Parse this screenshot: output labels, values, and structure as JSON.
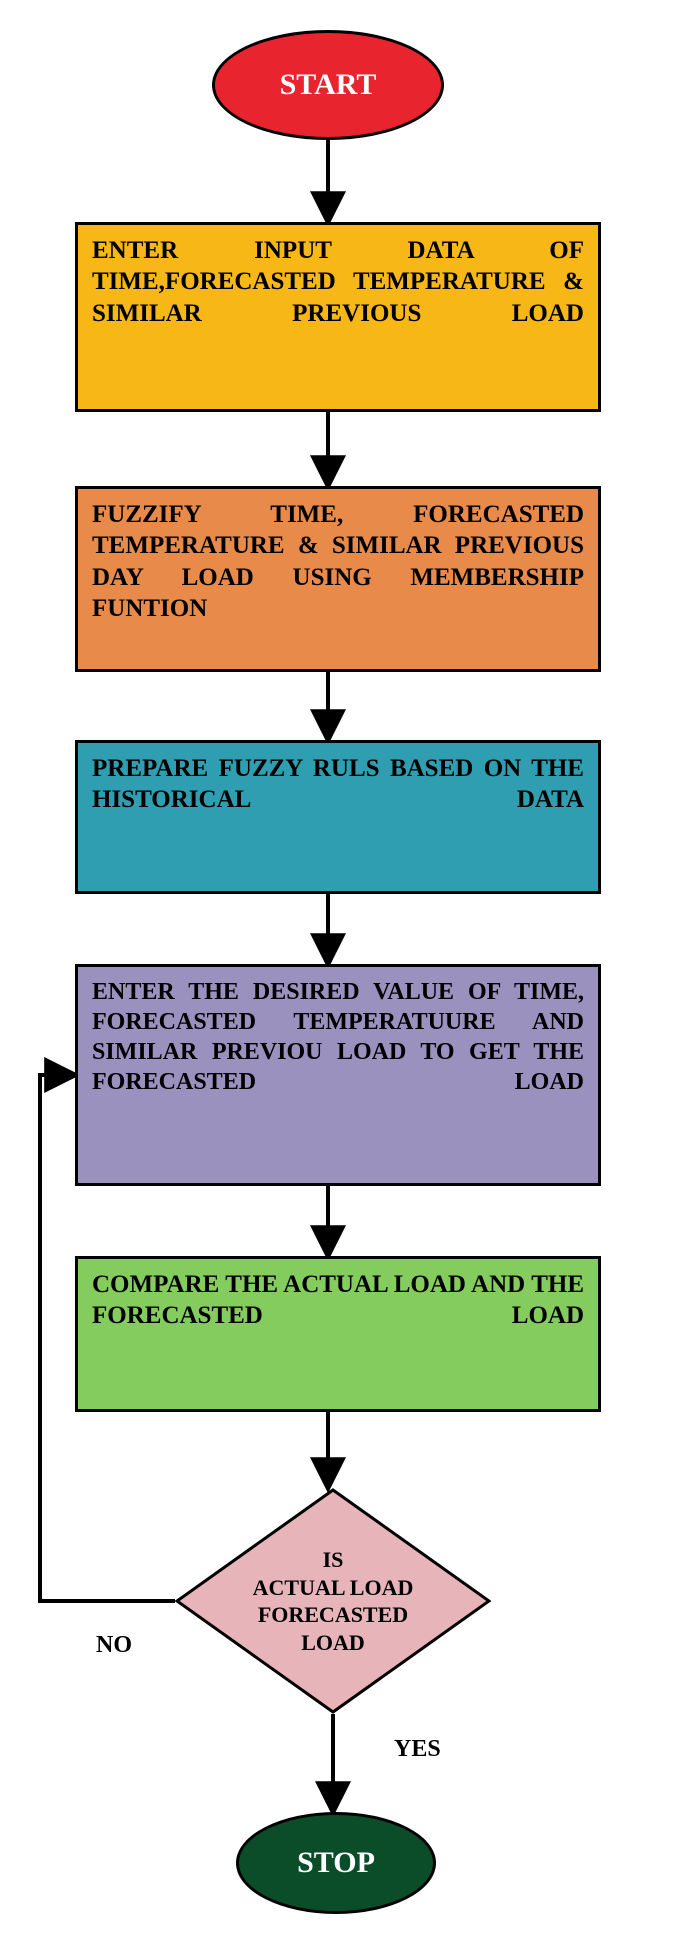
{
  "flow": {
    "start": "START",
    "stop": "STOP",
    "step1": "ENTER INPUT DATA OF TIME,FORECASTED TEMPERATURE & SIMILAR PREVIOUS LOAD",
    "step2": "FUZZIFY TIME, FORECASTED TEMPERATURE & SIMILAR PREVIOUS DAY LOAD USING MEMBERSHIP FUNTION",
    "step3": "PREPARE FUZZY RULS BASED ON THE HISTORICAL DATA",
    "step4": "ENTER THE DESIRED VALUE OF TIME, FORECASTED TEMPERATUURE AND SIMILAR PREVIOU LOAD TO GET THE FORECASTED LOAD",
    "step5": "COMPARE THE ACTUAL LOAD AND THE FORECASTED LOAD",
    "decision": "IS\nACTUAL LOAD\nFORECASTED\nLOAD",
    "no": "NO",
    "yes": "YES"
  }
}
